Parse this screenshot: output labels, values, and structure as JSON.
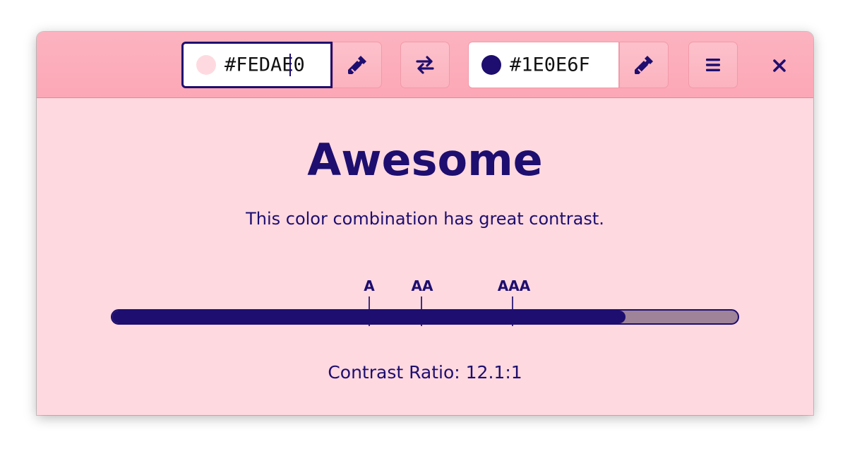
{
  "header": {
    "foreground_hex": "#FEDAE0",
    "background_hex": "#1E0E6F",
    "foreground_color": "#fedae0",
    "background_color": "#1e0e6f",
    "icons": {
      "fg_picker": "eyedropper-icon",
      "swap": "swap-arrows-icon",
      "bg_picker": "eyedropper-icon",
      "menu": "hamburger-menu-icon",
      "close": "close-icon"
    }
  },
  "result": {
    "title": "Awesome",
    "description": "This color combination has great contrast."
  },
  "levels": [
    {
      "label": "A"
    },
    {
      "label": "AA"
    },
    {
      "label": "AAA"
    }
  ],
  "contrast": {
    "ratio_text": "Contrast Ratio: 12.1:1",
    "bar_fill_fraction": 0.82
  },
  "colors": {
    "accent": "#1e0e6f",
    "window_bg": "#fed9e0",
    "headerbar_bg": "#fca7b6",
    "bar_unfilled": "#9e8399"
  }
}
